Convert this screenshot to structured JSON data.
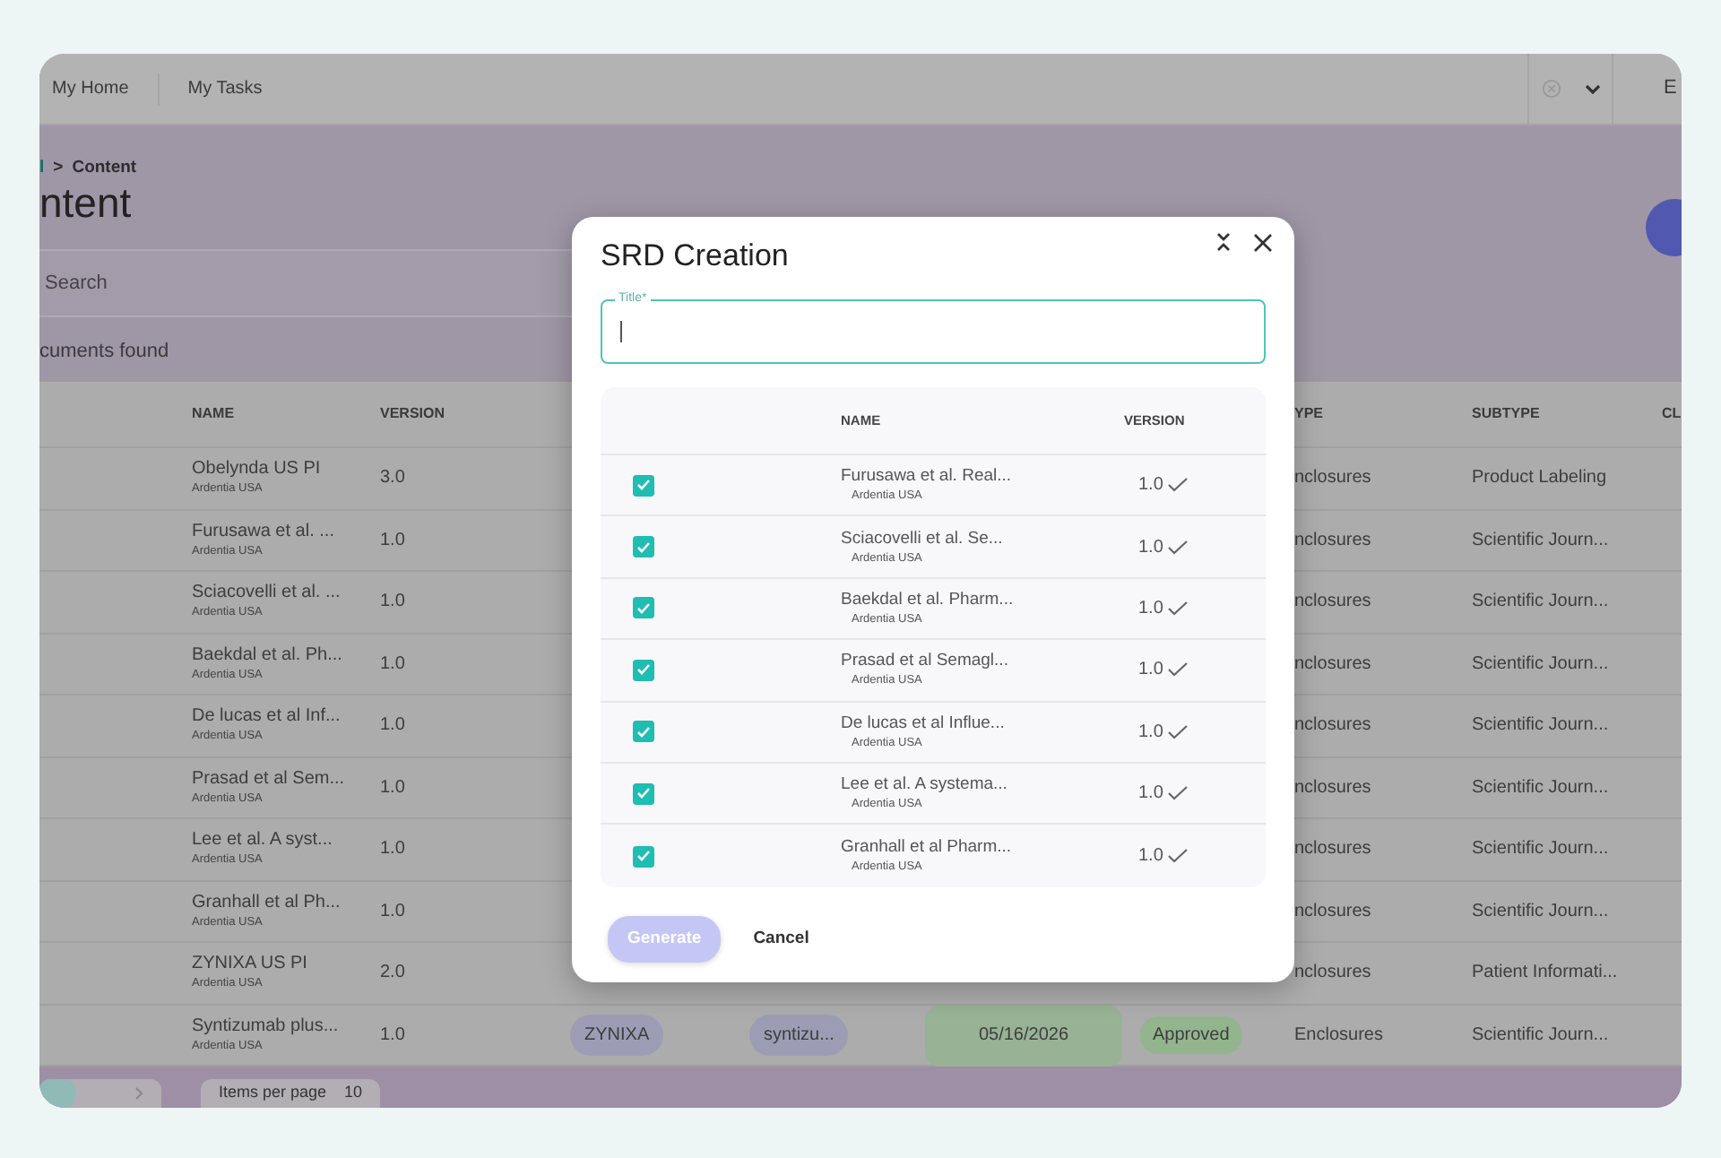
{
  "topbar": {
    "links": [
      "My Home",
      "My Tasks"
    ],
    "user_initial": "E"
  },
  "header": {
    "breadcrumb_parent": "l",
    "breadcrumb_separator": ">",
    "breadcrumb_current": "Content",
    "title": "ntent",
    "search_placeholder": "Search",
    "result_count": "cuments found"
  },
  "table": {
    "columns": [
      "NAME",
      "VERSION",
      "YPE",
      "SUBTYPE",
      "CL"
    ],
    "rows": [
      {
        "name": "Obelynda US PI",
        "org": "Ardentia USA",
        "version": "3.0",
        "type": "nclosures",
        "subtype": "Product Labeling"
      },
      {
        "name": "Furusawa et al. ...",
        "org": "Ardentia USA",
        "version": "1.0",
        "type": "nclosures",
        "subtype": "Scientific Journ..."
      },
      {
        "name": "Sciacovelli et al. ...",
        "org": "Ardentia USA",
        "version": "1.0",
        "type": "nclosures",
        "subtype": "Scientific Journ..."
      },
      {
        "name": "Baekdal et al. Ph...",
        "org": "Ardentia USA",
        "version": "1.0",
        "type": "nclosures",
        "subtype": "Scientific Journ..."
      },
      {
        "name": "De lucas et al Inf...",
        "org": "Ardentia USA",
        "version": "1.0",
        "type": "nclosures",
        "subtype": "Scientific Journ..."
      },
      {
        "name": "Prasad et al Sem...",
        "org": "Ardentia USA",
        "version": "1.0",
        "type": "nclosures",
        "subtype": "Scientific Journ..."
      },
      {
        "name": "Lee et al. A syst...",
        "org": "Ardentia USA",
        "version": "1.0",
        "type": "nclosures",
        "subtype": "Scientific Journ..."
      },
      {
        "name": "Granhall et al Ph...",
        "org": "Ardentia USA",
        "version": "1.0",
        "type": "nclosures",
        "subtype": "Scientific Journ..."
      },
      {
        "name": "ZYNIXA US PI",
        "org": "Ardentia USA",
        "version": "2.0",
        "type": "nclosures",
        "subtype": "Patient Informati..."
      },
      {
        "name": "Syntizumab plus...",
        "org": "Ardentia USA",
        "version": "1.0",
        "product": "ZYNIXA",
        "molecule": "syntizu...",
        "date": "05/16/2026",
        "status": "Approved",
        "type": "Enclosures",
        "subtype": "Scientific Journ..."
      }
    ]
  },
  "pagination": {
    "items_per_page_label": "Items per page",
    "items_per_page": "10"
  },
  "dialog": {
    "title": "SRD Creation",
    "title_field": {
      "label": "Title*"
    },
    "columns": [
      "NAME",
      "VERSION"
    ],
    "rows": [
      {
        "name": "Furusawa et al. Real...",
        "org": "Ardentia USA",
        "version": "1.0",
        "checked": true
      },
      {
        "name": "Sciacovelli et al. Se...",
        "org": "Ardentia USA",
        "version": "1.0",
        "checked": true
      },
      {
        "name": "Baekdal et al. Pharm...",
        "org": "Ardentia USA",
        "version": "1.0",
        "checked": true
      },
      {
        "name": "Prasad et al Semagl...",
        "org": "Ardentia USA",
        "version": "1.0",
        "checked": true
      },
      {
        "name": "De lucas et al Influe...",
        "org": "Ardentia USA",
        "version": "1.0",
        "checked": true
      },
      {
        "name": "Lee et al. A systema...",
        "org": "Ardentia USA",
        "version": "1.0",
        "checked": true
      },
      {
        "name": "Granhall et al Pharm...",
        "org": "Ardentia USA",
        "version": "1.0",
        "checked": true
      }
    ],
    "buttons": [
      {
        "label": "Generate",
        "disabled": true
      },
      {
        "label": "Cancel",
        "disabled": false
      }
    ]
  }
}
